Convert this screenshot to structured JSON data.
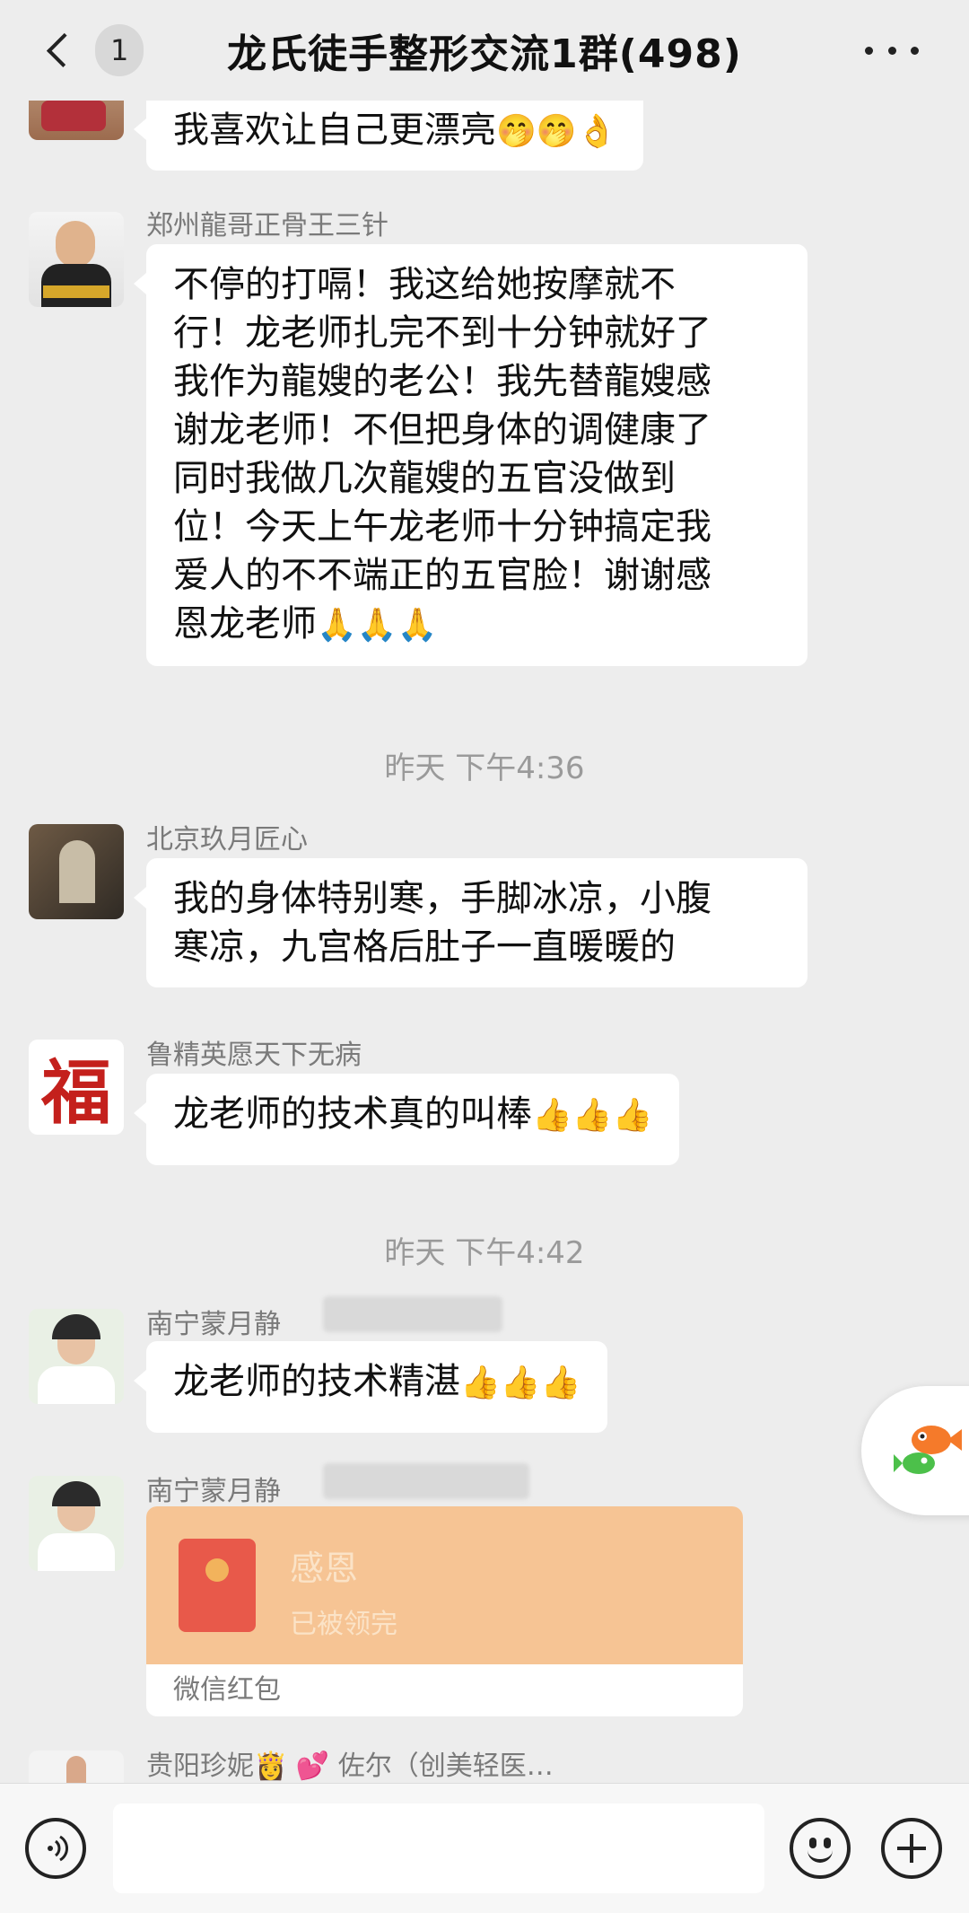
{
  "header": {
    "unread_count": "1",
    "title": "龙氏徒手整形交流1群(498)"
  },
  "messages": [
    {
      "text": "我喜欢让自己更漂亮",
      "emoji": "🤭🤭👌"
    },
    {
      "sender": "郑州龍哥正骨王三针",
      "lines": [
        "不停的打嗝！我这给她按摩就不",
        "行！龙老师扎完不到十分钟就好了",
        "我作为龍嫂的老公！我先替龍嫂感",
        "谢龙老师！不但把身体的调健康了",
        "同时我做几次龍嫂的五官没做到",
        "位！今天上午龙老师十分钟搞定我",
        "爱人的不不端正的五官脸！谢谢感",
        "恩龙老师"
      ],
      "emoji": "🙏🙏🙏"
    },
    {
      "timestamp": "昨天 下午4:36"
    },
    {
      "sender": "北京玖月匠心",
      "lines": [
        "我的身体特别寒，手脚冰凉，小腹",
        "寒凉，九宫格后肚子一直暖暖的"
      ]
    },
    {
      "sender": "鲁精英愿天下无病",
      "avatar_text": "福",
      "text": "龙老师的技术真的叫棒",
      "emoji": "👍👍👍"
    },
    {
      "timestamp": "昨天 下午4:42"
    },
    {
      "sender": "南宁蒙月静",
      "text": "龙老师的技术精湛",
      "emoji": "👍👍👍"
    },
    {
      "sender": "南宁蒙月静",
      "red_packet": {
        "title": "感恩",
        "status": "已被领完",
        "label": "微信红包"
      }
    },
    {
      "sender": "贵阳珍妮👸 💕 佐尔（创美轻医…"
    }
  ],
  "colors": {
    "background": "#ededed",
    "bubble": "#ffffff",
    "red_packet": "#f6c494",
    "red_packet_icon": "#e8594a"
  },
  "icons": [
    "back-chevron-icon",
    "more-icon",
    "voice-icon",
    "emoji-icon",
    "plus-icon",
    "red-packet-icon",
    "fish-widget-icon"
  ]
}
